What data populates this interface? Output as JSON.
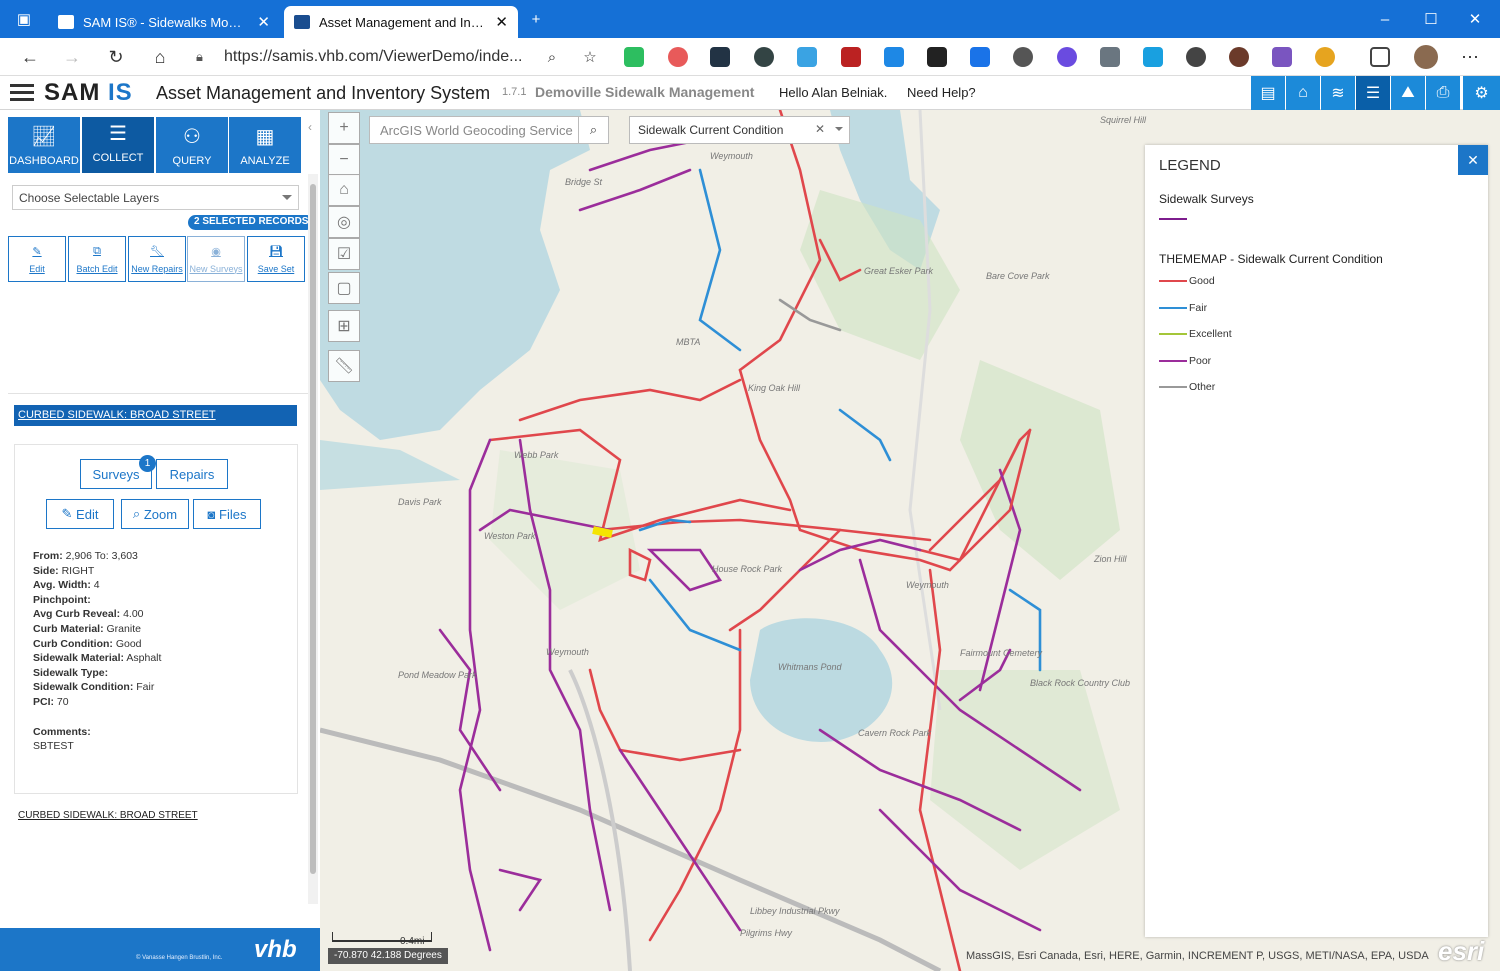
{
  "browser": {
    "tabs": [
      {
        "label": "SAM IS® - Sidewalks Module",
        "active": false
      },
      {
        "label": "Asset Management and Inventor",
        "active": true
      }
    ],
    "new_tab": "+",
    "url": "https://samis.vhb.com/ViewerDemo/inde...",
    "window_controls": {
      "min": "–",
      "max": "☐",
      "close": "✕"
    }
  },
  "app": {
    "logo_left": "SAM",
    "logo_right": "IS",
    "title": "Asset Management and Inventory System",
    "version": "1.7.1",
    "subtitle": "Demoville Sidewalk Management",
    "greeting": "Hello Alan Belniak.",
    "help": "Need Help?"
  },
  "sidebar": {
    "modules": [
      "DASHBOARD",
      "COLLECT",
      "QUERY",
      "ANALYZE"
    ],
    "active_module": "COLLECT",
    "layer_chooser": "Choose Selectable Layers",
    "selected_records": "2 SELECTED RECORDS",
    "actions": [
      "Edit",
      "Batch Edit",
      "New Repairs",
      "New Surveys",
      "Save Set"
    ],
    "record_title": "CURBED SIDEWALK: BROAD STREET",
    "tabs": {
      "surveys": "Surveys",
      "repairs": "Repairs",
      "badge": "1"
    },
    "buttons": {
      "edit": "Edit",
      "zoom": "Zoom",
      "files": "Files"
    },
    "attributes": [
      {
        "k": "From:",
        "v": "2,906 To: 3,603"
      },
      {
        "k": "Side:",
        "v": "RIGHT"
      },
      {
        "k": "Avg. Width:",
        "v": "4"
      },
      {
        "k": "Pinchpoint:",
        "v": ""
      },
      {
        "k": "Avg Curb Reveal:",
        "v": "4.00"
      },
      {
        "k": "Curb Material:",
        "v": "Granite"
      },
      {
        "k": "Curb Condition:",
        "v": "Good"
      },
      {
        "k": "Sidewalk Material:",
        "v": "Asphalt"
      },
      {
        "k": "Sidewalk Type:",
        "v": ""
      },
      {
        "k": "Sidewalk Condition:",
        "v": "Fair"
      },
      {
        "k": "PCI:",
        "v": "70"
      }
    ],
    "comments_label": "Comments:",
    "comments": "SBTEST",
    "record_footer": "CURBED SIDEWALK: BROAD STREET",
    "copyright": "© Vanasse Hangen Brustlin, Inc.",
    "vhb": "vhb"
  },
  "map": {
    "search_placeholder": "ArcGIS World Geocoding Service",
    "layer_select": "Sidewalk Current Condition",
    "scale": "0.4mi",
    "coords": "-70.870 42.188 Degrees",
    "attribution": "MassGIS, Esri Canada, Esri, HERE, Garmin, INCREMENT P, USGS, METI/NASA, EPA, USDA",
    "esri": "esri",
    "labels": [
      "Weymouth",
      "Bridge St",
      "Great Esker Park",
      "Bare Cove Park",
      "MBTA",
      "King Oak Hill",
      "Webb Park",
      "Weston Park",
      "Davis Park",
      "House Rock Park",
      "Weymouth",
      "Whitmans Pond",
      "Fairmount Cemetery",
      "Black Rock Country Club",
      "Cavern Rock Park",
      "Pond Meadow Park",
      "Zion Hill",
      "Weymouth",
      "Squirrel Hill",
      "Libbey Industrial Pkwy",
      "Pilgrims Hwy"
    ]
  },
  "legend": {
    "title": "LEGEND",
    "close": "✕",
    "surveys": "Sidewalk Surveys",
    "thememap": "THEMEMAP - Sidewalk Current Condition",
    "items": [
      {
        "label": "Good",
        "color": "#e0474c"
      },
      {
        "label": "Fair",
        "color": "#2e8fd6"
      },
      {
        "label": "Excellent",
        "color": "#a4c639"
      },
      {
        "label": "Poor",
        "color": "#9b2d9b"
      },
      {
        "label": "Other",
        "color": "#999999"
      }
    ]
  }
}
